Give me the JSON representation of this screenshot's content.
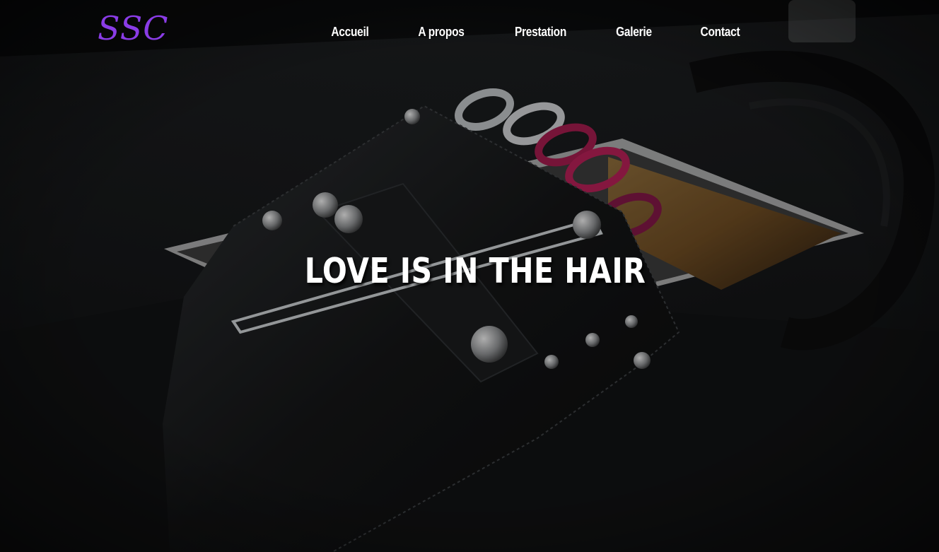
{
  "brand": {
    "logo_text": "SSC",
    "accent_color": "#8a3ce6"
  },
  "nav": {
    "items": [
      {
        "label": "Accueil"
      },
      {
        "label": "A propos"
      },
      {
        "label": "Prestation"
      },
      {
        "label": "Galerie"
      },
      {
        "label": "Contact"
      }
    ]
  },
  "hero": {
    "title": "LOVE IS IN THE HAIR",
    "background_image": "hairdresser-scissor-holster-photo"
  }
}
